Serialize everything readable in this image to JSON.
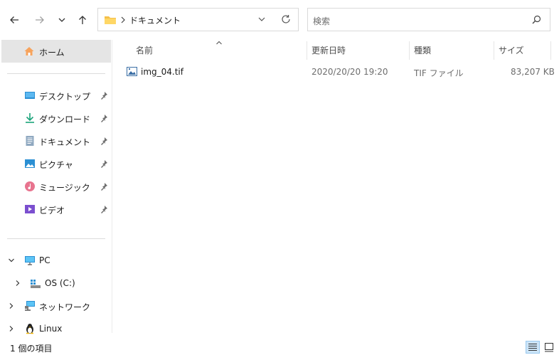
{
  "toolbar": {
    "address_path": "ドキュメント",
    "search_placeholder": "検索"
  },
  "nav": {
    "home": "ホーム",
    "quick_access": [
      {
        "label": "デスクトップ",
        "icon": "desktop-icon"
      },
      {
        "label": "ダウンロード",
        "icon": "download-icon"
      },
      {
        "label": "ドキュメント",
        "icon": "document-icon"
      },
      {
        "label": "ピクチャ",
        "icon": "pictures-icon"
      },
      {
        "label": "ミュージック",
        "icon": "music-icon"
      },
      {
        "label": "ビデオ",
        "icon": "video-icon"
      }
    ],
    "pc": "PC",
    "os_drive": "OS (C:)",
    "network": "ネットワーク",
    "linux": "Linux"
  },
  "columns": {
    "name": "名前",
    "modified": "更新日時",
    "type": "種類",
    "size": "サイズ"
  },
  "files": [
    {
      "name": "img_04.tif",
      "modified": "2020/20/20 19:20",
      "type": "TIF ファイル",
      "size": "83,207 KB"
    }
  ],
  "status": {
    "item_count": "1 個の項目"
  },
  "colors": {
    "selection": "#e5e5e5",
    "accent": "#0078d4",
    "folder": "#f5c04a"
  }
}
